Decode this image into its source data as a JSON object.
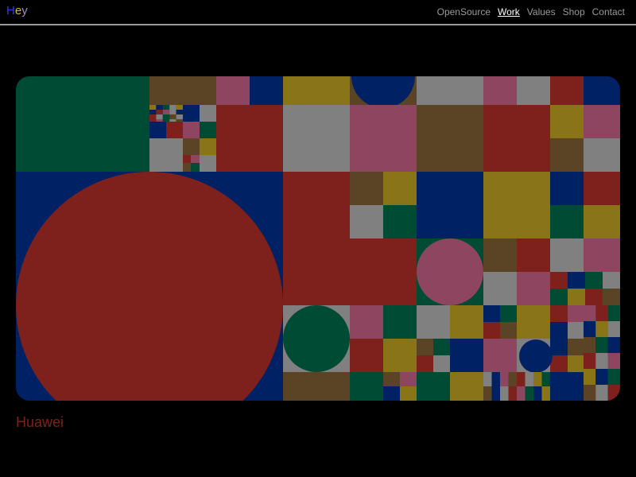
{
  "header": {
    "logo": {
      "letters": [
        {
          "char": "H",
          "color": "#3a3ad6"
        },
        {
          "char": "e",
          "color": "#cdbd2d"
        },
        {
          "char": "y",
          "color": "#a48ac8"
        }
      ]
    },
    "nav": [
      {
        "key": "opensource",
        "label": "OpenSource",
        "active": false
      },
      {
        "key": "work",
        "label": "Work",
        "active": true
      },
      {
        "key": "values",
        "label": "Values",
        "active": false
      },
      {
        "key": "shop",
        "label": "Shop",
        "active": false
      },
      {
        "key": "contact",
        "label": "Contact",
        "active": false
      }
    ]
  },
  "project": {
    "title": "Huawei",
    "title_color": "#7e211d",
    "palette": {
      "green": "#004b33",
      "brown": "#5b4326",
      "pink": "#8e4560",
      "blue": "#002164",
      "olive": "#8a7418",
      "gray": "#808080",
      "red": "#7e211d"
    }
  }
}
